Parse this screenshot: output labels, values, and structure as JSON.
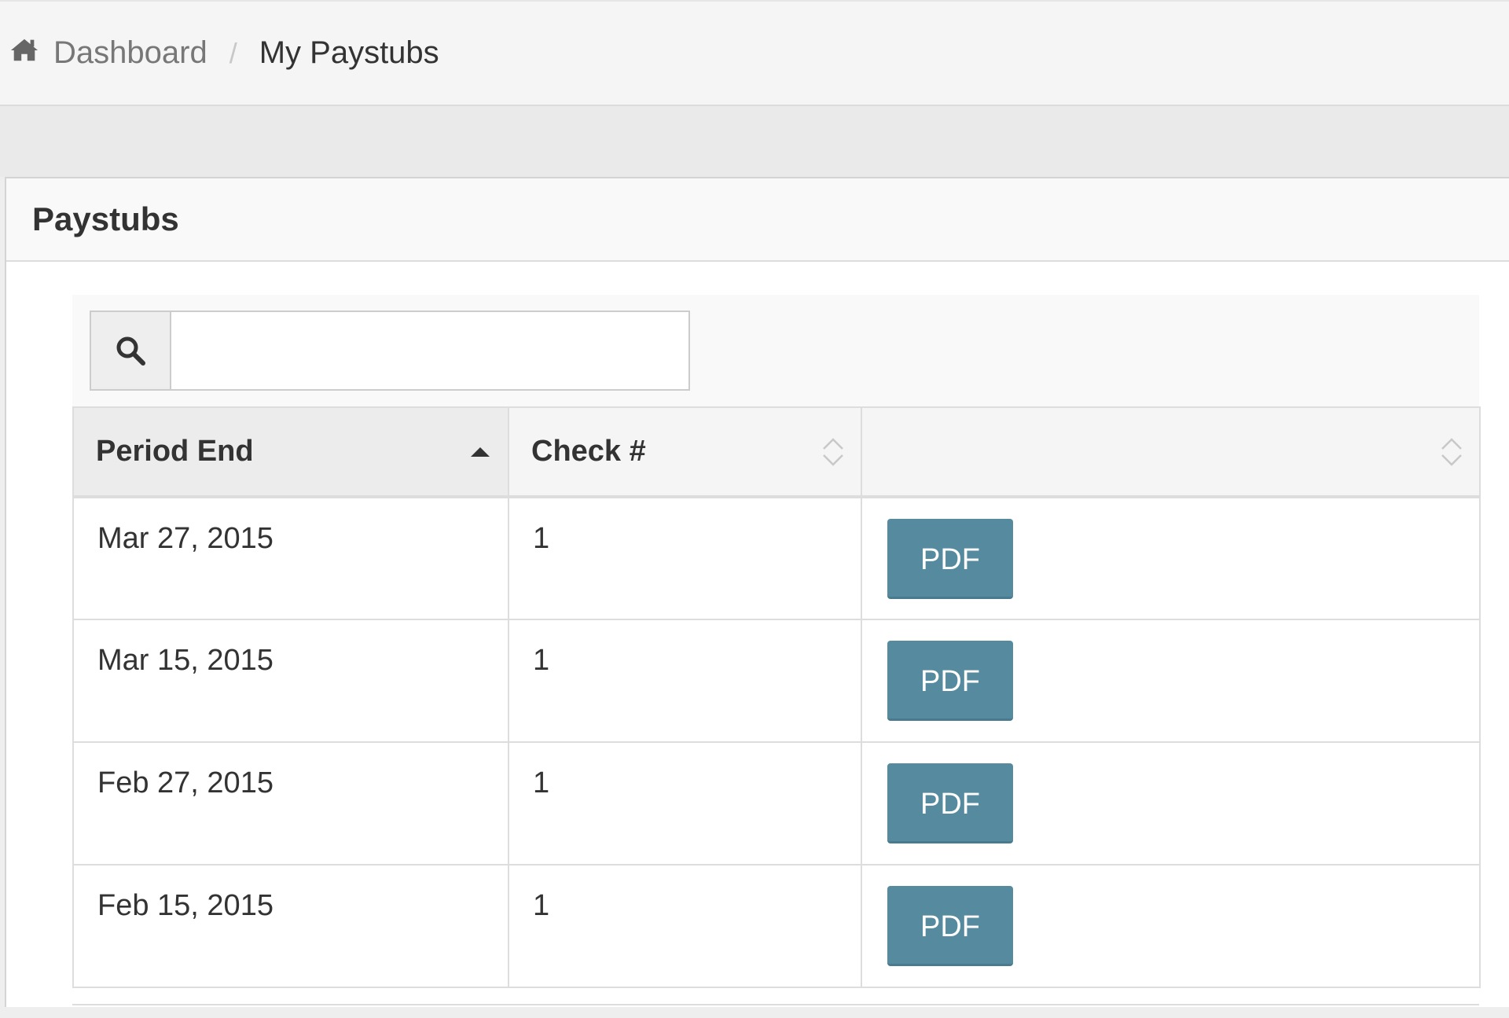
{
  "breadcrumb": {
    "home_label": "Dashboard",
    "separator": "/",
    "current_label": "My Paystubs"
  },
  "panel": {
    "title": "Paystubs"
  },
  "search": {
    "value": "",
    "placeholder": ""
  },
  "table": {
    "columns": [
      {
        "label": "Period End",
        "sort": "ascending"
      },
      {
        "label": "Check #",
        "sort": "none"
      },
      {
        "label": "",
        "sort": "none"
      }
    ],
    "rows": [
      {
        "period_end": "Mar 27, 2015",
        "check": "1",
        "action": "PDF"
      },
      {
        "period_end": "Mar 15, 2015",
        "check": "1",
        "action": "PDF"
      },
      {
        "period_end": "Feb 27, 2015",
        "check": "1",
        "action": "PDF"
      },
      {
        "period_end": "Feb 15, 2015",
        "check": "1",
        "action": "PDF"
      }
    ]
  },
  "icons": {
    "home": "home-icon",
    "search": "search-icon",
    "sort_asc": "sort-asc-icon",
    "sort_both": "sort-both-icon"
  },
  "colors": {
    "pdf_button": "#558a9f",
    "header_bg": "#f5f5f5"
  }
}
